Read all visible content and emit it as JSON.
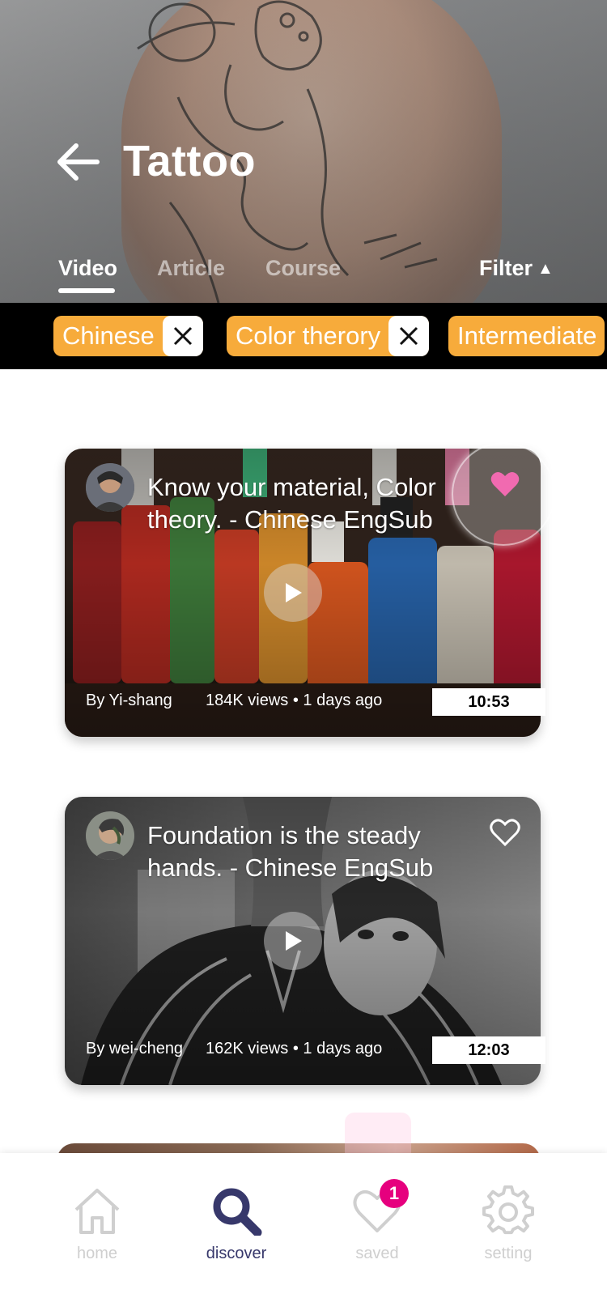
{
  "header": {
    "title": "Tattoo",
    "tabs": [
      {
        "label": "Video",
        "active": true
      },
      {
        "label": "Article",
        "active": false
      },
      {
        "label": "Course",
        "active": false
      }
    ],
    "filter_label": "Filter",
    "filter_icon": "triangle-up-icon"
  },
  "chips": [
    {
      "label": "Chinese"
    },
    {
      "label": "Color therory"
    },
    {
      "label": "Intermediate"
    }
  ],
  "videos": [
    {
      "title": "Know your material, Color theory. - Chinese EngSub",
      "author": "By Yi-shang",
      "stats": "184K views • 1 days ago",
      "duration": "10:53",
      "liked": true
    },
    {
      "title": "Foundation is the steady hands. - Chinese EngSub",
      "author": "By wei-cheng",
      "stats": "162K views • 1 days ago",
      "duration": "12:03",
      "liked": false
    }
  ],
  "bottom_nav": {
    "items": [
      {
        "label": "home",
        "icon": "home-icon",
        "active": false
      },
      {
        "label": "discover",
        "icon": "search-icon",
        "active": true
      },
      {
        "label": "saved",
        "icon": "heart-icon",
        "active": false,
        "badge": "1"
      },
      {
        "label": "setting",
        "icon": "gear-icon",
        "active": false
      }
    ]
  },
  "colors": {
    "chip": "#f7ab3b",
    "heart_liked": "#f16ab0",
    "nav_active": "#37386b",
    "badge": "#e6007e"
  }
}
